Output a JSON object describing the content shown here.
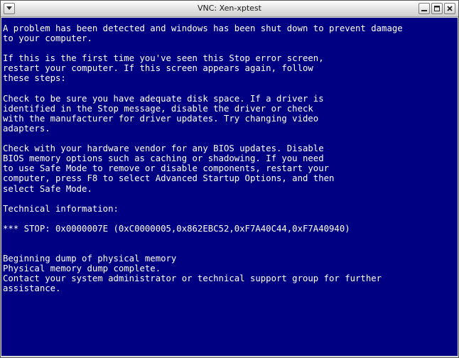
{
  "window": {
    "title": "VNC: Xen-xptest"
  },
  "bsod": {
    "lines": [
      "A problem has been detected and windows has been shut down to prevent damage",
      "to your computer.",
      "",
      "If this is the first time you've seen this Stop error screen,",
      "restart your computer. If this screen appears again, follow",
      "these steps:",
      "",
      "Check to be sure you have adequate disk space. If a driver is",
      "identified in the Stop message, disable the driver or check",
      "with the manufacturer for driver updates. Try changing video",
      "adapters.",
      "",
      "Check with your hardware vendor for any BIOS updates. Disable",
      "BIOS memory options such as caching or shadowing. If you need",
      "to use Safe Mode to remove or disable components, restart your",
      "computer, press F8 to select Advanced Startup Options, and then",
      "select Safe Mode.",
      "",
      "Technical information:",
      "",
      "*** STOP: 0x0000007E (0xC0000005,0x862EBC52,0xF7A40C44,0xF7A40940)",
      "",
      "",
      "Beginning dump of physical memory",
      "Physical memory dump complete.",
      "Contact your system administrator or technical support group for further",
      "assistance."
    ]
  },
  "colors": {
    "screen_background": "#000082",
    "screen_text": "#ffffff"
  },
  "icons": {
    "system_menu": "window-menu-icon",
    "minimize": "minimize-icon",
    "maximize": "maximize-icon",
    "close": "close-icon"
  }
}
